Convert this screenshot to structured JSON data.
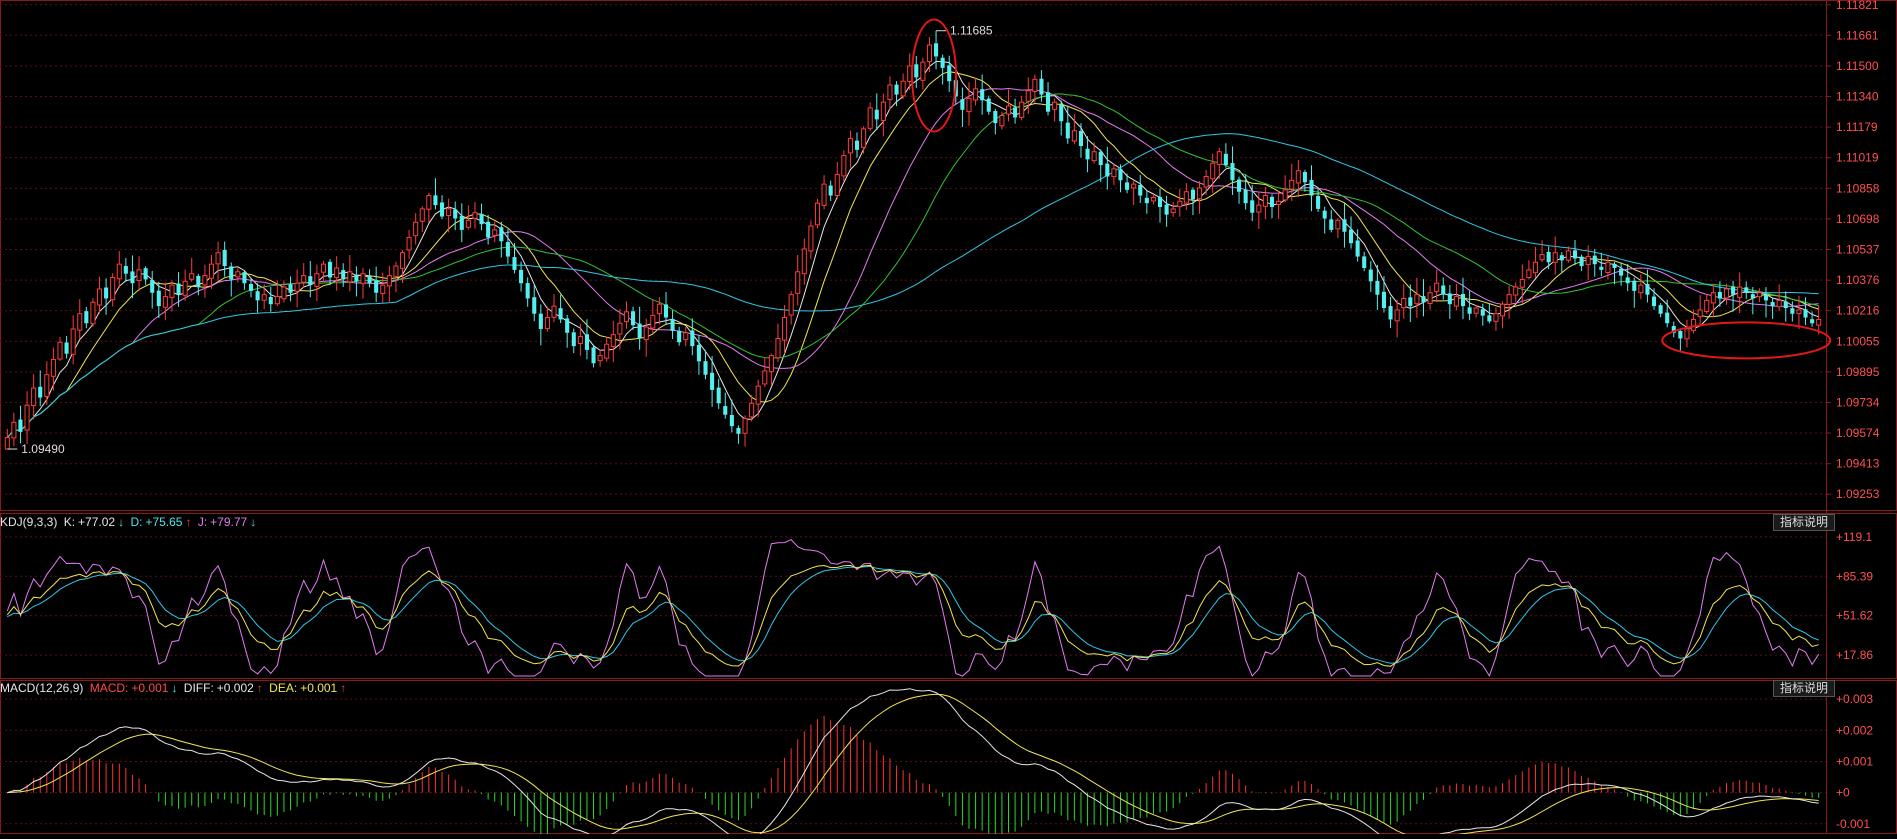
{
  "colors": {
    "background": "#000000",
    "grid": "#5a1010",
    "border": "#8a1a1a",
    "up_candle": "#ff3b3b",
    "down_candle": "#54f0f0",
    "ma5": "#e6e6e6",
    "ma10": "#f0e650",
    "ma20": "#e27cf0",
    "ma30": "#33c233",
    "ma60": "#2ec7e6",
    "axis_text": "#ff5050",
    "annotation_circle": "#e01818"
  },
  "price_panel": {
    "high_label": "1.11685",
    "low_label": "1.09490"
  },
  "kdj_panel": {
    "legend": {
      "name": "KDJ(9,3,3)",
      "k_label": "K:",
      "k_value": "+77.02",
      "k_arrow": "↓",
      "d_label": "D:",
      "d_value": "+75.65",
      "d_arrow": "↑",
      "j_label": "J:",
      "j_value": "+79.77",
      "j_arrow": "↓"
    },
    "button": "指标说明"
  },
  "macd_panel": {
    "legend": {
      "name": "MACD(12,26,9)",
      "macd_label": "MACD:",
      "macd_value": "+0.001",
      "macd_arrow": "↓",
      "diff_label": "DIFF:",
      "diff_value": "+0.002",
      "diff_arrow": "↑",
      "dea_label": "DEA:",
      "dea_value": "+0.001",
      "dea_arrow": "↑"
    },
    "button": "指标说明"
  },
  "chart_data": [
    {
      "type": "candlestick",
      "ylim": [
        1.0917,
        1.1182
      ],
      "y_ticks": [
        "1.11821",
        "1.11661",
        "1.11500",
        "1.11340",
        "1.11179",
        "1.11019",
        "1.10858",
        "1.10698",
        "1.10537",
        "1.10376",
        "1.10216",
        "1.10055",
        "1.09895",
        "1.09734",
        "1.09574",
        "1.09413",
        "1.09253"
      ],
      "ma_periods": [
        5,
        10,
        20,
        30,
        60
      ],
      "annotations": [
        "high-circle",
        "low-circle"
      ],
      "close": [
        1.0955,
        1.0963,
        1.0958,
        1.0972,
        1.0981,
        1.0976,
        1.0988,
        1.0996,
        1.1005,
        1.0999,
        1.1012,
        1.102,
        1.1015,
        1.1026,
        1.1033,
        1.1028,
        1.1039,
        1.1046,
        1.1041,
        1.1036,
        1.1043,
        1.1038,
        1.1031,
        1.1024,
        1.1029,
        1.1035,
        1.103,
        1.1037,
        1.1041,
        1.1034,
        1.104,
        1.1046,
        1.1052,
        1.1045,
        1.1038,
        1.1042,
        1.1036,
        1.1032,
        1.1027,
        1.103,
        1.1025,
        1.1029,
        1.1034,
        1.1031,
        1.1036,
        1.104,
        1.1035,
        1.1041,
        1.1046,
        1.1039,
        1.1044,
        1.1038,
        1.1042,
        1.1037,
        1.1041,
        1.1036,
        1.1031,
        1.1035,
        1.104,
        1.1045,
        1.1052,
        1.106,
        1.1068,
        1.1075,
        1.1082,
        1.1077,
        1.1071,
        1.1075,
        1.107,
        1.1064,
        1.1069,
        1.1073,
        1.1067,
        1.106,
        1.1064,
        1.1058,
        1.105,
        1.1043,
        1.1036,
        1.1028,
        1.102,
        1.1012,
        1.1018,
        1.1024,
        1.1017,
        1.101,
        1.1003,
        1.1008,
        1.1001,
        1.0994,
        1.0998,
        1.1004,
        1.1009,
        1.1015,
        1.1021,
        1.1014,
        1.1007,
        1.1013,
        1.1019,
        1.1025,
        1.1018,
        1.1011,
        1.1005,
        1.101,
        1.1003,
        1.0995,
        1.0988,
        1.098,
        1.0973,
        1.0967,
        1.0961,
        1.0957,
        1.0965,
        1.0973,
        1.0982,
        1.099,
        1.0998,
        1.1007,
        1.1018,
        1.103,
        1.1042,
        1.1054,
        1.1066,
        1.1078,
        1.1088,
        1.1082,
        1.1093,
        1.1103,
        1.1112,
        1.1106,
        1.1117,
        1.1128,
        1.1122,
        1.1131,
        1.114,
        1.1135,
        1.1142,
        1.115,
        1.1144,
        1.1152,
        1.1161,
        1.1155,
        1.1149,
        1.1142,
        1.1134,
        1.1127,
        1.1133,
        1.1138,
        1.1132,
        1.1126,
        1.112,
        1.1124,
        1.1129,
        1.1123,
        1.1131,
        1.1137,
        1.1143,
        1.1135,
        1.1126,
        1.1131,
        1.1121,
        1.1112,
        1.1116,
        1.1108,
        1.1101,
        1.1105,
        1.1098,
        1.1092,
        1.1096,
        1.109,
        1.1085,
        1.1088,
        1.1082,
        1.1078,
        1.1081,
        1.1076,
        1.1072,
        1.1075,
        1.1079,
        1.1084,
        1.108,
        1.1086,
        1.1092,
        1.1099,
        1.1105,
        1.1098,
        1.109,
        1.1084,
        1.1078,
        1.1073,
        1.1077,
        1.1082,
        1.1076,
        1.1079,
        1.1085,
        1.109,
        1.1095,
        1.1089,
        1.1082,
        1.1075,
        1.107,
        1.1064,
        1.1069,
        1.1063,
        1.1057,
        1.105,
        1.1044,
        1.1037,
        1.103,
        1.1023,
        1.1017,
        1.1022,
        1.1028,
        1.1024,
        1.103,
        1.1026,
        1.1031,
        1.1036,
        1.103,
        1.1025,
        1.1029,
        1.1024,
        1.102,
        1.1023,
        1.1019,
        1.1016,
        1.102,
        1.1025,
        1.103,
        1.1034,
        1.1038,
        1.1043,
        1.1047,
        1.1051,
        1.1047,
        1.1052,
        1.1048,
        1.1053,
        1.1049,
        1.1045,
        1.105,
        1.1046,
        1.1043,
        1.1047,
        1.1044,
        1.104,
        1.1036,
        1.1032,
        1.1035,
        1.103,
        1.1024,
        1.102,
        1.1015,
        1.101,
        1.1007,
        1.1012,
        1.1017,
        1.1022,
        1.1027,
        1.1031,
        1.1028,
        1.1033,
        1.103,
        1.1034,
        1.1031,
        1.1028,
        1.1031,
        1.1027,
        1.1024,
        1.1027,
        1.1023,
        1.102,
        1.1022,
        1.1018,
        1.1015,
        1.1017
      ]
    },
    {
      "type": "line",
      "title": "KDJ(9,3,3)",
      "ylim": [
        0,
        125
      ],
      "y_ticks": [
        "+119.1",
        "+85.39",
        "+51.62",
        "+17.86"
      ],
      "series": [
        {
          "name": "K"
        },
        {
          "name": "D"
        },
        {
          "name": "J"
        }
      ]
    },
    {
      "type": "bar+line",
      "title": "MACD(12,26,9)",
      "ylim": [
        -0.0012,
        0.0031
      ],
      "y_ticks": [
        "+0.003",
        "+0.002",
        "+0.001",
        "+0",
        "-0.001"
      ],
      "series": [
        {
          "name": "MACD"
        },
        {
          "name": "DIFF"
        },
        {
          "name": "DEA"
        }
      ]
    }
  ]
}
